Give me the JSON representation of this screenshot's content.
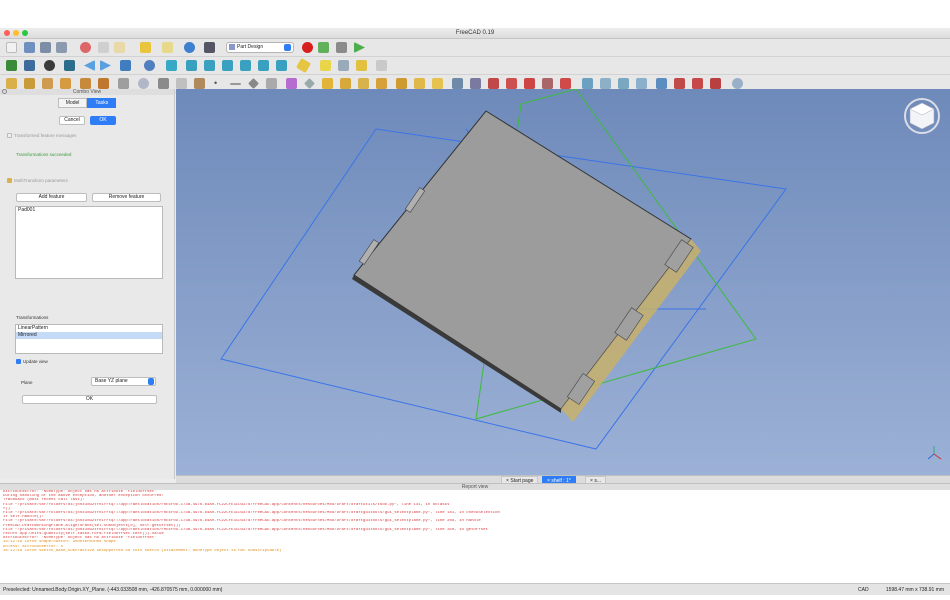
{
  "window": {
    "title": "FreeCAD 0.19"
  },
  "colors": {
    "accent": "#2f7df6",
    "viewport_top": "#6e8aba",
    "error": "#d83a3a",
    "warning": "#e08a10",
    "success": "#3c9b3c"
  },
  "toolbar": {
    "workbench": "Part Design",
    "icons_row1": [
      "new-icon",
      "open-icon",
      "save-icon",
      "save-as-icon",
      "cut-icon",
      "copy-icon",
      "paste-icon",
      "undo-icon",
      "redo-icon",
      "refresh-icon",
      "whats-this-icon",
      "record-macro-icon",
      "stop-macro-icon",
      "macros-icon",
      "run-macro-icon"
    ],
    "icons_row2": [
      "fit-all-icon",
      "fit-selection-icon",
      "draw-style-icon",
      "sync-view-icon",
      "back-icon",
      "forward-icon",
      "std-views-icon",
      "zoom-icon",
      "isometric-icon",
      "front-icon",
      "top-icon",
      "right-icon",
      "rear-icon",
      "bottom-icon",
      "left-icon",
      "measure-icon",
      "part-icon",
      "body-icon",
      "group-icon",
      "link-icon"
    ],
    "icons_row3": [
      "create-sketch-icon",
      "edit-sketch-icon",
      "validate-sketch-icon",
      "check-geometry-icon",
      "attach-sketch-icon",
      "map-sketch-icon",
      "point-icon",
      "line-icon",
      "plane-icon",
      "cs-icon",
      "shape-binder-icon",
      "clone-icon",
      "pad-icon",
      "pocket-icon",
      "revolution-icon",
      "groove-icon",
      "hole-icon",
      "loft-icon",
      "pipe-icon",
      "fillet-icon",
      "chamfer-icon",
      "draft-icon",
      "thickness-icon",
      "mirrored-icon",
      "linear-pattern-icon",
      "polar-pattern-icon",
      "multi-transform-icon",
      "boolean-icon"
    ]
  },
  "combo": {
    "title": "Combo View",
    "tab_model": "Model",
    "tab_tasks": "Tasks",
    "cancel": "Cancel",
    "ok": "OK",
    "messages_label": "Transformed feature messages",
    "status_ok": "Transformations succeeded",
    "params_label": "MultiTransform parameters",
    "add_feature": "Add feature",
    "remove_feature": "Remove feature",
    "features": [
      "Pad001"
    ],
    "transformations_label": "Transformations",
    "transformations": [
      "LinearPattern",
      "Mirrored"
    ],
    "selected_transformation": "Mirrored",
    "update_view": "Update view",
    "plane_label": "Plane",
    "plane_value": "Base YZ plane",
    "ok2": "OK"
  },
  "view_tabs": {
    "start": "Start page",
    "shelf": "shelf : 1*",
    "other": "s..."
  },
  "report": {
    "title": "Report view",
    "lines": [
      {
        "t": "AttributeError: 'NoneType' object has no attribute 'fieldOffset'",
        "c": "red"
      },
      {
        "t": "",
        "c": "red"
      },
      {
        "t": "During handling of the above exception, another exception occurred:",
        "c": "red"
      },
      {
        "t": "",
        "c": "red"
      },
      {
        "t": "Traceback (most recent call last):",
        "c": "red"
      },
      {
        "t": "  File \"/private/var/folders/d4/jbhz3xw2tfh1rrtq/T/AppTranslocation/FREEF0D-173B-4976-84A0-FC22CFE3CD33/d/FreeCAD.app/Contents/Resources/Mod/Draft/draftutils/todo.py\", line 141, in doTasks",
        "c": "red"
      },
      {
        "t": "    f()",
        "c": "red"
      },
      {
        "t": "  File \"/private/var/folders/d4/jbhz3xw2tfh1rrtq/T/AppTranslocation/FREEF0D-173B-4976-84A0-FC22CFE3CD33/d/FreeCAD.app/Contents/Resources/Mod/Draft/draftguitools/gui_selectplane.py\", line 181, in checkSelection",
        "c": "red"
      },
      {
        "t": "    if self.handle():",
        "c": "red"
      },
      {
        "t": "  File \"/private/var/folders/d4/jbhz3xw2tfh1rrtq/T/AppTranslocation/FREEF0D-173B-4976-84A0-FC22CFE3CD33/d/FreeCAD.app/Contents/Resources/Mod/Draft/draftguitools/gui_selectplane.py\", line 208, in handle",
        "c": "red"
      },
      {
        "t": "    FreeCAD.DraftWorkingPlane.alignToFace(sel.SubObjects[0], self.getOffset())",
        "c": "red"
      },
      {
        "t": "  File \"/private/var/folders/d4/jbhz3xw2tfh1rrtq/T/AppTranslocation/FREEF0D-173B-4976-84A0-FC22CFE3CD33/d/FreeCAD.app/Contents/Resources/Mod/Draft/draftguitools/gui_selectplane.py\", line 350, in getOffset",
        "c": "red"
      },
      {
        "t": "    return App.Units.Quantity(self.taskd.form.fieldOffset.text()).Value",
        "c": "red"
      },
      {
        "t": "AttributeError: 'NoneType' object has no attribute 'fieldOffset'",
        "c": "red"
      },
      {
        "t": "",
        "c": "red"
      },
      {
        "t": "16:12:18  Curve shape/Sketch: undetermined shape",
        "c": "orange"
      },
      {
        "t": "  unless:  Attributeerror: s",
        "c": "orange"
      },
      {
        "t": "16:12:18  Curve sketch_base_subtractive unsupported on this sketch (Attachment: NoneType object is not subscriptable)",
        "c": "orange"
      }
    ]
  },
  "status": {
    "preselected": "Preselected: Unnamed.Body.Origin.XY_Plane. (-443.033508 mm, -426.870575 mm, 0.000000 mm)",
    "nav": "CAD",
    "dims": "1598.47 mm x 738.91 mm"
  }
}
